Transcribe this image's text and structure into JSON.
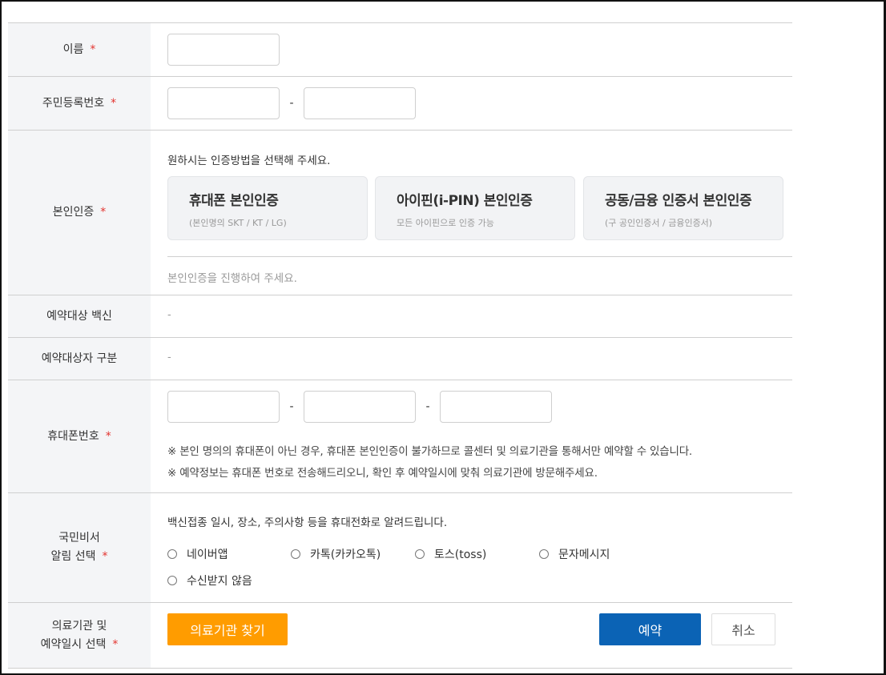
{
  "name_row": {
    "label": "이름",
    "required_mark": "*"
  },
  "ssn_row": {
    "label": "주민등록번호",
    "required_mark": "*",
    "separator": "-"
  },
  "auth_row": {
    "label": "본인인증",
    "required_mark": "*",
    "instruction": "원하시는 인증방법을 선택해 주세요.",
    "methods": [
      {
        "title": "휴대폰 본인인증",
        "subtitle": "(본인명의 SKT / KT / LG)"
      },
      {
        "title": "아이핀(i-PIN) 본인인증",
        "subtitle": "모든 아이핀으로 인증 가능"
      },
      {
        "title": "공동/금융 인증서 본인인증",
        "subtitle": "(구 공인인증서 / 금융인증서)"
      }
    ],
    "status": "본인인증을 진행하여 주세요."
  },
  "vaccine_row": {
    "label": "예약대상 백신",
    "value": "-"
  },
  "target_row": {
    "label": "예약대상자 구분",
    "value": "-"
  },
  "phone_row": {
    "label": "휴대폰번호",
    "required_mark": "*",
    "separator": "-",
    "notes": [
      "※ 본인 명의의 휴대폰이 아닌 경우, 휴대폰 본인인증이 불가하므로 콜센터 및 의료기관을 통해서만 예약할 수 있습니다.",
      "※ 예약정보는 휴대폰 번호로 전송해드리오니, 확인 후 예약일시에 맞춰 의료기관에 방문해주세요."
    ]
  },
  "notify_row": {
    "label_line1": "국민비서",
    "label_line2": "알림 선택",
    "required_mark": "*",
    "description": "백신접종 일시, 장소, 주의사항 등을 휴대전화로 알려드립니다.",
    "options": [
      "네이버앱",
      "카톡(카카오톡)",
      "토스(toss)",
      "문자메시지",
      "수신받지 않음"
    ]
  },
  "hospital_row": {
    "label_line1": "의료기관 및",
    "label_line2": "예약일시 선택",
    "required_mark": "*",
    "find_button": "의료기관 찾기",
    "reserve_button": "예약",
    "cancel_button": "취소"
  },
  "colors": {
    "accent_orange": "#ff9c00",
    "primary_blue": "#0b63b5",
    "required_red": "#e3342f",
    "label_bg": "#f4f5f7"
  }
}
